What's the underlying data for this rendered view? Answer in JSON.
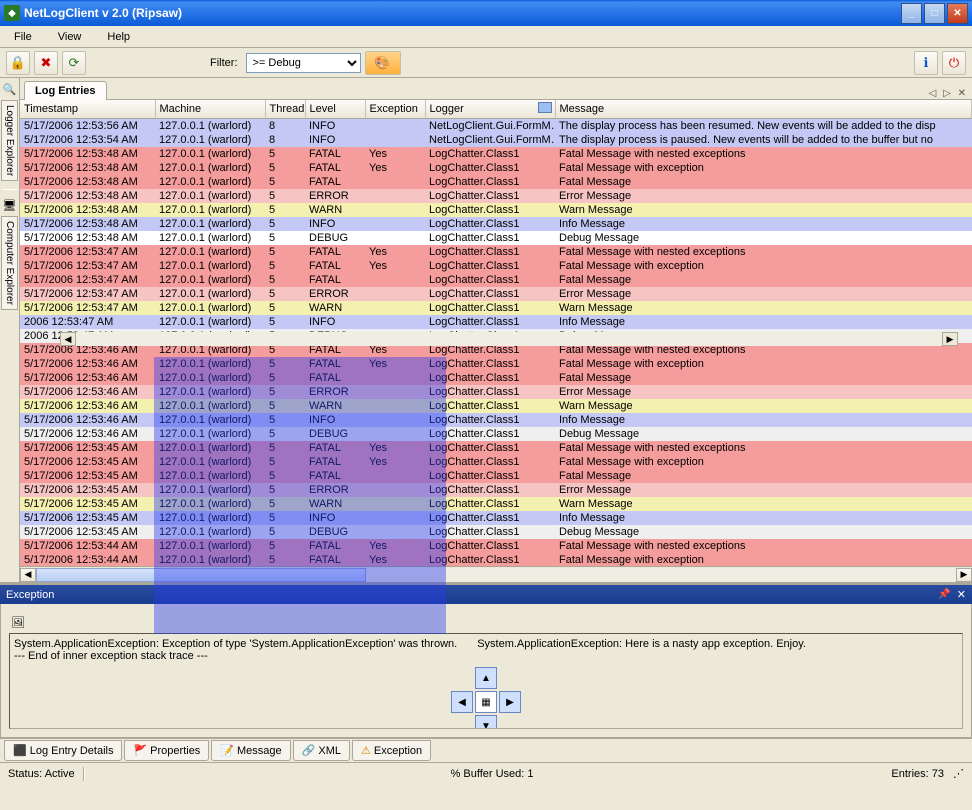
{
  "title": "NetLogClient v 2.0 (Ripsaw)",
  "menu": {
    "file": "File",
    "view": "View",
    "help": "Help"
  },
  "toolbar": {
    "filter_label": "Filter:",
    "filter_value": ">= Debug"
  },
  "sidebar": {
    "tab1": "Logger Explorer",
    "tab2": "Computer Explorer"
  },
  "tabs": {
    "log_entries": "Log Entries",
    "controls": "◁  ▷  ✕"
  },
  "columns": {
    "timestamp": "Timestamp",
    "machine": "Machine",
    "thread": "Thread",
    "level": "Level",
    "exception": "Exception",
    "logger": "Logger",
    "message": "Message"
  },
  "rows": [
    {
      "cls": "row-info",
      "ts": "5/17/2006 12:53:56 AM",
      "mc": "127.0.0.1 (warlord)",
      "th": "8",
      "lv": "INFO",
      "ex": "",
      "lg": "NetLogClient.Gui.FormM…",
      "ms": "The display process has been resumed.  New events will be added to the disp"
    },
    {
      "cls": "row-info",
      "ts": "5/17/2006 12:53:54 AM",
      "mc": "127.0.0.1 (warlord)",
      "th": "8",
      "lv": "INFO",
      "ex": "",
      "lg": "NetLogClient.Gui.FormM…",
      "ms": "The display process is paused.  New events will be added to the buffer but no"
    },
    {
      "cls": "row-fatal",
      "ts": "5/17/2006 12:53:48 AM",
      "mc": "127.0.0.1 (warlord)",
      "th": "5",
      "lv": "FATAL",
      "ex": "Yes",
      "lg": "LogChatter.Class1",
      "ms": "Fatal Message with nested exceptions"
    },
    {
      "cls": "row-fatal",
      "ts": "5/17/2006 12:53:48 AM",
      "mc": "127.0.0.1 (warlord)",
      "th": "5",
      "lv": "FATAL",
      "ex": "Yes",
      "lg": "LogChatter.Class1",
      "ms": "Fatal Message with exception"
    },
    {
      "cls": "row-fatal",
      "ts": "5/17/2006 12:53:48 AM",
      "mc": "127.0.0.1 (warlord)",
      "th": "5",
      "lv": "FATAL",
      "ex": "",
      "lg": "LogChatter.Class1",
      "ms": "Fatal Message"
    },
    {
      "cls": "row-error",
      "ts": "5/17/2006 12:53:48 AM",
      "mc": "127.0.0.1 (warlord)",
      "th": "5",
      "lv": "ERROR",
      "ex": "",
      "lg": "LogChatter.Class1",
      "ms": "Error Message"
    },
    {
      "cls": "row-warn",
      "ts": "5/17/2006 12:53:48 AM",
      "mc": "127.0.0.1 (warlord)",
      "th": "5",
      "lv": "WARN",
      "ex": "",
      "lg": "LogChatter.Class1",
      "ms": "Warn Message"
    },
    {
      "cls": "row-info",
      "ts": "5/17/2006 12:53:48 AM",
      "mc": "127.0.0.1 (warlord)",
      "th": "5",
      "lv": "INFO",
      "ex": "",
      "lg": "LogChatter.Class1",
      "ms": "Info Message"
    },
    {
      "cls": "row-white",
      "ts": "5/17/2006 12:53:48 AM",
      "mc": "127.0.0.1 (warlord)",
      "th": "5",
      "lv": "DEBUG",
      "ex": "",
      "lg": "LogChatter.Class1",
      "ms": "Debug Message"
    },
    {
      "cls": "row-fatal",
      "ts": "5/17/2006 12:53:47 AM",
      "mc": "127.0.0.1 (warlord)",
      "th": "5",
      "lv": "FATAL",
      "ex": "Yes",
      "lg": "LogChatter.Class1",
      "ms": "Fatal Message with nested exceptions"
    },
    {
      "cls": "row-fatal",
      "ts": "5/17/2006 12:53:47 AM",
      "mc": "127.0.0.1 (warlord)",
      "th": "5",
      "lv": "FATAL",
      "ex": "Yes",
      "lg": "LogChatter.Class1",
      "ms": "Fatal Message with exception"
    },
    {
      "cls": "row-fatal",
      "ts": "5/17/2006 12:53:47 AM",
      "mc": "127.0.0.1 (warlord)",
      "th": "5",
      "lv": "FATAL",
      "ex": "",
      "lg": "LogChatter.Class1",
      "ms": "Fatal Message"
    },
    {
      "cls": "row-error",
      "ts": "5/17/2006 12:53:47 AM",
      "mc": "127.0.0.1 (warlord)",
      "th": "5",
      "lv": "ERROR",
      "ex": "",
      "lg": "LogChatter.Class1",
      "ms": "Error Message"
    },
    {
      "cls": "row-warn",
      "ts": "5/17/2006 12:53:47 AM",
      "mc": "127.0.0.1 (warlord)",
      "th": "5",
      "lv": "WARN",
      "ex": "",
      "lg": "LogChatter.Class1",
      "ms": "Warn Message"
    },
    {
      "cls": "row-info",
      "ts": "2006 12:53:47 AM",
      "mc": "127.0.0.1 (warlord)",
      "th": "5",
      "lv": "INFO",
      "ex": "",
      "lg": "LogChatter.Class1",
      "ms": "Info Message"
    },
    {
      "cls": "row-debug",
      "ts": "2006 12:53:47 AM",
      "mc": "127.0.0.1 (warlord)",
      "th": "5",
      "lv": "DEBUG",
      "ex": "",
      "lg": "LogChatter.Class1",
      "ms": "Debug Message"
    },
    {
      "cls": "row-fatal",
      "ts": "5/17/2006 12:53:46 AM",
      "mc": "127.0.0.1 (warlord)",
      "th": "5",
      "lv": "FATAL",
      "ex": "Yes",
      "lg": "LogChatter.Class1",
      "ms": "Fatal Message with nested exceptions"
    },
    {
      "cls": "row-fatal",
      "ts": "5/17/2006 12:53:46 AM",
      "mc": "127.0.0.1 (warlord)",
      "th": "5",
      "lv": "FATAL",
      "ex": "Yes",
      "lg": "LogChatter.Class1",
      "ms": "Fatal Message with exception"
    },
    {
      "cls": "row-fatal",
      "ts": "5/17/2006 12:53:46 AM",
      "mc": "127.0.0.1 (warlord)",
      "th": "5",
      "lv": "FATAL",
      "ex": "",
      "lg": "LogChatter.Class1",
      "ms": "Fatal Message"
    },
    {
      "cls": "row-error",
      "ts": "5/17/2006 12:53:46 AM",
      "mc": "127.0.0.1 (warlord)",
      "th": "5",
      "lv": "ERROR",
      "ex": "",
      "lg": "LogChatter.Class1",
      "ms": "Error Message"
    },
    {
      "cls": "row-warn",
      "ts": "5/17/2006 12:53:46 AM",
      "mc": "127.0.0.1 (warlord)",
      "th": "5",
      "lv": "WARN",
      "ex": "",
      "lg": "LogChatter.Class1",
      "ms": "Warn Message"
    },
    {
      "cls": "row-info",
      "ts": "5/17/2006 12:53:46 AM",
      "mc": "127.0.0.1 (warlord)",
      "th": "5",
      "lv": "INFO",
      "ex": "",
      "lg": "LogChatter.Class1",
      "ms": "Info Message"
    },
    {
      "cls": "row-debug",
      "ts": "5/17/2006 12:53:46 AM",
      "mc": "127.0.0.1 (warlord)",
      "th": "5",
      "lv": "DEBUG",
      "ex": "",
      "lg": "LogChatter.Class1",
      "ms": "Debug Message"
    },
    {
      "cls": "row-fatal",
      "ts": "5/17/2006 12:53:45 AM",
      "mc": "127.0.0.1 (warlord)",
      "th": "5",
      "lv": "FATAL",
      "ex": "Yes",
      "lg": "LogChatter.Class1",
      "ms": "Fatal Message with nested exceptions"
    },
    {
      "cls": "row-fatal",
      "ts": "5/17/2006 12:53:45 AM",
      "mc": "127.0.0.1 (warlord)",
      "th": "5",
      "lv": "FATAL",
      "ex": "Yes",
      "lg": "LogChatter.Class1",
      "ms": "Fatal Message with exception"
    },
    {
      "cls": "row-fatal",
      "ts": "5/17/2006 12:53:45 AM",
      "mc": "127.0.0.1 (warlord)",
      "th": "5",
      "lv": "FATAL",
      "ex": "",
      "lg": "LogChatter.Class1",
      "ms": "Fatal Message"
    },
    {
      "cls": "row-error",
      "ts": "5/17/2006 12:53:45 AM",
      "mc": "127.0.0.1 (warlord)",
      "th": "5",
      "lv": "ERROR",
      "ex": "",
      "lg": "LogChatter.Class1",
      "ms": "Error Message"
    },
    {
      "cls": "row-warn",
      "ts": "5/17/2006 12:53:45 AM",
      "mc": "127.0.0.1 (warlord)",
      "th": "5",
      "lv": "WARN",
      "ex": "",
      "lg": "LogChatter.Class1",
      "ms": "Warn Message"
    },
    {
      "cls": "row-info",
      "ts": "5/17/2006 12:53:45 AM",
      "mc": "127.0.0.1 (warlord)",
      "th": "5",
      "lv": "INFO",
      "ex": "",
      "lg": "LogChatter.Class1",
      "ms": "Info Message"
    },
    {
      "cls": "row-debug",
      "ts": "5/17/2006 12:53:45 AM",
      "mc": "127.0.0.1 (warlord)",
      "th": "5",
      "lv": "DEBUG",
      "ex": "",
      "lg": "LogChatter.Class1",
      "ms": "Debug Message"
    },
    {
      "cls": "row-fatal",
      "ts": "5/17/2006 12:53:44 AM",
      "mc": "127.0.0.1 (warlord)",
      "th": "5",
      "lv": "FATAL",
      "ex": "Yes",
      "lg": "LogChatter.Class1",
      "ms": "Fatal Message with nested exceptions"
    },
    {
      "cls": "row-fatal",
      "ts": "5/17/2006 12:53:44 AM",
      "mc": "127.0.0.1 (warlord)",
      "th": "5",
      "lv": "FATAL",
      "ex": "Yes",
      "lg": "LogChatter.Class1",
      "ms": "Fatal Message with exception"
    }
  ],
  "exception": {
    "title": "Exception",
    "text_line1": "System.ApplicationException: Exception of type 'System.ApplicationException' was thrown.",
    "text_right": "System.ApplicationException: Here is a nasty app exception.  Enjoy.",
    "text_line2": "   --- End of inner exception stack trace ---"
  },
  "bottom_tabs": {
    "details": "Log Entry Details",
    "properties": "Properties",
    "message": "Message",
    "xml": "XML",
    "exception": "Exception"
  },
  "status": {
    "status": "Status: Active",
    "buffer": "% Buffer Used: 1",
    "entries": "Entries: 73"
  }
}
